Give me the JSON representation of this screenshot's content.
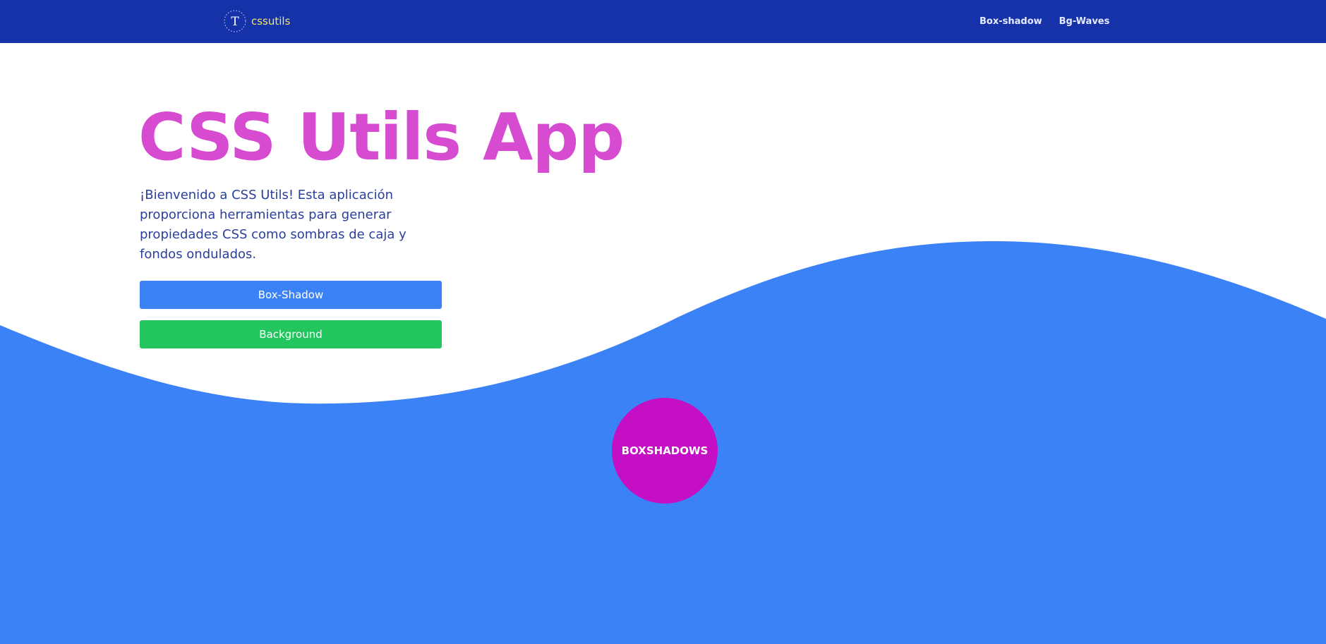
{
  "colors": {
    "navbar": "#1632a8",
    "brand_text": "#f2e66b",
    "nav_link": "#e6ebff",
    "title": "#d64bd0",
    "description": "#2a3f9c",
    "wave": "#3b82f6",
    "btn_boxshadow": "#3b82f6",
    "btn_background": "#22c55e",
    "circle": "#c50fc5"
  },
  "navbar": {
    "brand": {
      "logo_letter": "T",
      "logo_icon": "circular-letter-T-logo",
      "text": "cssutils"
    },
    "links": [
      {
        "label": "Box-shadow"
      },
      {
        "label": "Bg-Waves"
      }
    ]
  },
  "hero": {
    "title": "CSS Utils App",
    "description": "¡Bienvenido a CSS Utils! Esta aplicación proporciona herramientas para generar propiedades CSS como sombras de caja y fondos ondulados.",
    "buttons": {
      "box_shadow": "Box-Shadow",
      "background": "Background"
    }
  },
  "circle": {
    "label": "BOXSHADOWS"
  }
}
